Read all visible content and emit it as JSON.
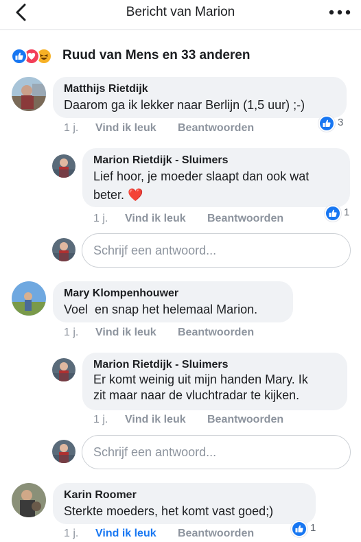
{
  "header": {
    "title": "Bericht van Marion",
    "back_icon": "chevron-left-icon",
    "more_icon": "more-horizontal-icon"
  },
  "reactions": {
    "icons": [
      "like-icon",
      "love-icon",
      "haha-icon"
    ],
    "summary": "Ruud van Mens en 33 anderen"
  },
  "comments": [
    {
      "author": "Matthijs Rietdijk",
      "text": "Daarom ga ik lekker naar Berlijn (1,5 uur) ;-)",
      "time": "1 j.",
      "like_label": "Vind ik leuk",
      "reply_label": "Beantwoorden",
      "like_count": "3",
      "replies": [
        {
          "author": "Marion Rietdijk - Sluimers",
          "text_line1": "Lief hoor, je moeder slaapt dan ook wat",
          "text_line2": "beter.",
          "emoji": "❤️",
          "time": "1 j.",
          "like_label": "Vind ik leuk",
          "reply_label": "Beantwoorden",
          "like_count": "1"
        }
      ],
      "reply_placeholder": "Schrijf een antwoord..."
    },
    {
      "author": "Mary Klompenhouwer",
      "text": "Voel  en snap het helemaal Marion.",
      "time": "1 j.",
      "like_label": "Vind ik leuk",
      "reply_label": "Beantwoorden",
      "replies": [
        {
          "author": "Marion Rietdijk - Sluimers",
          "text_line1": "Er komt weinig uit mijn handen Mary. Ik",
          "text_line2": "zit maar naar de vluchtradar te kijken.",
          "time": "1 j.",
          "like_label": "Vind ik leuk",
          "reply_label": "Beantwoorden"
        }
      ],
      "reply_placeholder": "Schrijf een antwoord..."
    },
    {
      "author": "Karin Roomer",
      "text": "Sterkte moeders, het komt vast goed;)",
      "time": "1 j.",
      "like_label": "Vind ik leuk",
      "like_active": true,
      "reply_label": "Beantwoorden",
      "like_count": "1"
    }
  ],
  "colors": {
    "accent": "#1877f2",
    "bubble": "#f0f2f5",
    "meta_text": "#8d949e"
  }
}
